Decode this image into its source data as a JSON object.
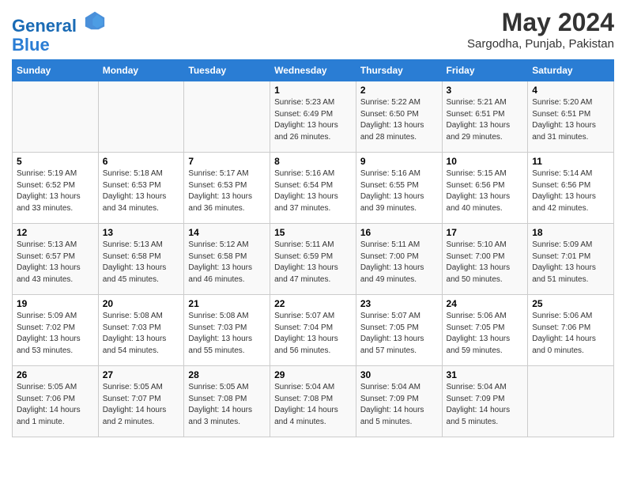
{
  "header": {
    "logo_line1": "General",
    "logo_line2": "Blue",
    "month_year": "May 2024",
    "location": "Sargodha, Punjab, Pakistan"
  },
  "weekdays": [
    "Sunday",
    "Monday",
    "Tuesday",
    "Wednesday",
    "Thursday",
    "Friday",
    "Saturday"
  ],
  "weeks": [
    [
      {
        "day": "",
        "info": ""
      },
      {
        "day": "",
        "info": ""
      },
      {
        "day": "",
        "info": ""
      },
      {
        "day": "1",
        "info": "Sunrise: 5:23 AM\nSunset: 6:49 PM\nDaylight: 13 hours\nand 26 minutes."
      },
      {
        "day": "2",
        "info": "Sunrise: 5:22 AM\nSunset: 6:50 PM\nDaylight: 13 hours\nand 28 minutes."
      },
      {
        "day": "3",
        "info": "Sunrise: 5:21 AM\nSunset: 6:51 PM\nDaylight: 13 hours\nand 29 minutes."
      },
      {
        "day": "4",
        "info": "Sunrise: 5:20 AM\nSunset: 6:51 PM\nDaylight: 13 hours\nand 31 minutes."
      }
    ],
    [
      {
        "day": "5",
        "info": "Sunrise: 5:19 AM\nSunset: 6:52 PM\nDaylight: 13 hours\nand 33 minutes."
      },
      {
        "day": "6",
        "info": "Sunrise: 5:18 AM\nSunset: 6:53 PM\nDaylight: 13 hours\nand 34 minutes."
      },
      {
        "day": "7",
        "info": "Sunrise: 5:17 AM\nSunset: 6:53 PM\nDaylight: 13 hours\nand 36 minutes."
      },
      {
        "day": "8",
        "info": "Sunrise: 5:16 AM\nSunset: 6:54 PM\nDaylight: 13 hours\nand 37 minutes."
      },
      {
        "day": "9",
        "info": "Sunrise: 5:16 AM\nSunset: 6:55 PM\nDaylight: 13 hours\nand 39 minutes."
      },
      {
        "day": "10",
        "info": "Sunrise: 5:15 AM\nSunset: 6:56 PM\nDaylight: 13 hours\nand 40 minutes."
      },
      {
        "day": "11",
        "info": "Sunrise: 5:14 AM\nSunset: 6:56 PM\nDaylight: 13 hours\nand 42 minutes."
      }
    ],
    [
      {
        "day": "12",
        "info": "Sunrise: 5:13 AM\nSunset: 6:57 PM\nDaylight: 13 hours\nand 43 minutes."
      },
      {
        "day": "13",
        "info": "Sunrise: 5:13 AM\nSunset: 6:58 PM\nDaylight: 13 hours\nand 45 minutes."
      },
      {
        "day": "14",
        "info": "Sunrise: 5:12 AM\nSunset: 6:58 PM\nDaylight: 13 hours\nand 46 minutes."
      },
      {
        "day": "15",
        "info": "Sunrise: 5:11 AM\nSunset: 6:59 PM\nDaylight: 13 hours\nand 47 minutes."
      },
      {
        "day": "16",
        "info": "Sunrise: 5:11 AM\nSunset: 7:00 PM\nDaylight: 13 hours\nand 49 minutes."
      },
      {
        "day": "17",
        "info": "Sunrise: 5:10 AM\nSunset: 7:00 PM\nDaylight: 13 hours\nand 50 minutes."
      },
      {
        "day": "18",
        "info": "Sunrise: 5:09 AM\nSunset: 7:01 PM\nDaylight: 13 hours\nand 51 minutes."
      }
    ],
    [
      {
        "day": "19",
        "info": "Sunrise: 5:09 AM\nSunset: 7:02 PM\nDaylight: 13 hours\nand 53 minutes."
      },
      {
        "day": "20",
        "info": "Sunrise: 5:08 AM\nSunset: 7:03 PM\nDaylight: 13 hours\nand 54 minutes."
      },
      {
        "day": "21",
        "info": "Sunrise: 5:08 AM\nSunset: 7:03 PM\nDaylight: 13 hours\nand 55 minutes."
      },
      {
        "day": "22",
        "info": "Sunrise: 5:07 AM\nSunset: 7:04 PM\nDaylight: 13 hours\nand 56 minutes."
      },
      {
        "day": "23",
        "info": "Sunrise: 5:07 AM\nSunset: 7:05 PM\nDaylight: 13 hours\nand 57 minutes."
      },
      {
        "day": "24",
        "info": "Sunrise: 5:06 AM\nSunset: 7:05 PM\nDaylight: 13 hours\nand 59 minutes."
      },
      {
        "day": "25",
        "info": "Sunrise: 5:06 AM\nSunset: 7:06 PM\nDaylight: 14 hours\nand 0 minutes."
      }
    ],
    [
      {
        "day": "26",
        "info": "Sunrise: 5:05 AM\nSunset: 7:06 PM\nDaylight: 14 hours\nand 1 minute."
      },
      {
        "day": "27",
        "info": "Sunrise: 5:05 AM\nSunset: 7:07 PM\nDaylight: 14 hours\nand 2 minutes."
      },
      {
        "day": "28",
        "info": "Sunrise: 5:05 AM\nSunset: 7:08 PM\nDaylight: 14 hours\nand 3 minutes."
      },
      {
        "day": "29",
        "info": "Sunrise: 5:04 AM\nSunset: 7:08 PM\nDaylight: 14 hours\nand 4 minutes."
      },
      {
        "day": "30",
        "info": "Sunrise: 5:04 AM\nSunset: 7:09 PM\nDaylight: 14 hours\nand 5 minutes."
      },
      {
        "day": "31",
        "info": "Sunrise: 5:04 AM\nSunset: 7:09 PM\nDaylight: 14 hours\nand 5 minutes."
      },
      {
        "day": "",
        "info": ""
      }
    ]
  ]
}
